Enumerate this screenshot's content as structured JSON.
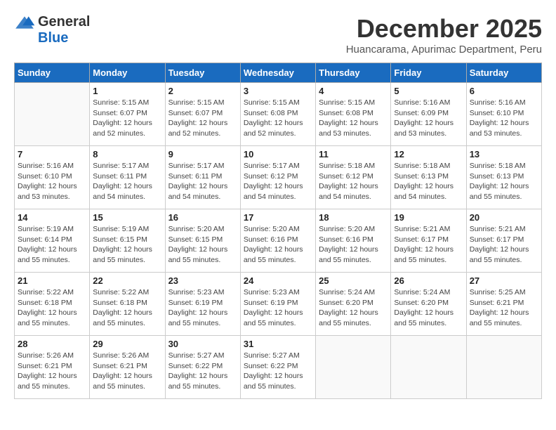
{
  "logo": {
    "general": "General",
    "blue": "Blue"
  },
  "title": {
    "month": "December 2025",
    "location": "Huancarama, Apurimac Department, Peru"
  },
  "weekdays": [
    "Sunday",
    "Monday",
    "Tuesday",
    "Wednesday",
    "Thursday",
    "Friday",
    "Saturday"
  ],
  "weeks": [
    [
      {
        "day": "",
        "sunrise": "",
        "sunset": "",
        "daylight": ""
      },
      {
        "day": "1",
        "sunrise": "Sunrise: 5:15 AM",
        "sunset": "Sunset: 6:07 PM",
        "daylight": "Daylight: 12 hours and 52 minutes."
      },
      {
        "day": "2",
        "sunrise": "Sunrise: 5:15 AM",
        "sunset": "Sunset: 6:07 PM",
        "daylight": "Daylight: 12 hours and 52 minutes."
      },
      {
        "day": "3",
        "sunrise": "Sunrise: 5:15 AM",
        "sunset": "Sunset: 6:08 PM",
        "daylight": "Daylight: 12 hours and 52 minutes."
      },
      {
        "day": "4",
        "sunrise": "Sunrise: 5:15 AM",
        "sunset": "Sunset: 6:08 PM",
        "daylight": "Daylight: 12 hours and 53 minutes."
      },
      {
        "day": "5",
        "sunrise": "Sunrise: 5:16 AM",
        "sunset": "Sunset: 6:09 PM",
        "daylight": "Daylight: 12 hours and 53 minutes."
      },
      {
        "day": "6",
        "sunrise": "Sunrise: 5:16 AM",
        "sunset": "Sunset: 6:10 PM",
        "daylight": "Daylight: 12 hours and 53 minutes."
      }
    ],
    [
      {
        "day": "7",
        "sunrise": "Sunrise: 5:16 AM",
        "sunset": "Sunset: 6:10 PM",
        "daylight": "Daylight: 12 hours and 53 minutes."
      },
      {
        "day": "8",
        "sunrise": "Sunrise: 5:17 AM",
        "sunset": "Sunset: 6:11 PM",
        "daylight": "Daylight: 12 hours and 54 minutes."
      },
      {
        "day": "9",
        "sunrise": "Sunrise: 5:17 AM",
        "sunset": "Sunset: 6:11 PM",
        "daylight": "Daylight: 12 hours and 54 minutes."
      },
      {
        "day": "10",
        "sunrise": "Sunrise: 5:17 AM",
        "sunset": "Sunset: 6:12 PM",
        "daylight": "Daylight: 12 hours and 54 minutes."
      },
      {
        "day": "11",
        "sunrise": "Sunrise: 5:18 AM",
        "sunset": "Sunset: 6:12 PM",
        "daylight": "Daylight: 12 hours and 54 minutes."
      },
      {
        "day": "12",
        "sunrise": "Sunrise: 5:18 AM",
        "sunset": "Sunset: 6:13 PM",
        "daylight": "Daylight: 12 hours and 54 minutes."
      },
      {
        "day": "13",
        "sunrise": "Sunrise: 5:18 AM",
        "sunset": "Sunset: 6:13 PM",
        "daylight": "Daylight: 12 hours and 55 minutes."
      }
    ],
    [
      {
        "day": "14",
        "sunrise": "Sunrise: 5:19 AM",
        "sunset": "Sunset: 6:14 PM",
        "daylight": "Daylight: 12 hours and 55 minutes."
      },
      {
        "day": "15",
        "sunrise": "Sunrise: 5:19 AM",
        "sunset": "Sunset: 6:15 PM",
        "daylight": "Daylight: 12 hours and 55 minutes."
      },
      {
        "day": "16",
        "sunrise": "Sunrise: 5:20 AM",
        "sunset": "Sunset: 6:15 PM",
        "daylight": "Daylight: 12 hours and 55 minutes."
      },
      {
        "day": "17",
        "sunrise": "Sunrise: 5:20 AM",
        "sunset": "Sunset: 6:16 PM",
        "daylight": "Daylight: 12 hours and 55 minutes."
      },
      {
        "day": "18",
        "sunrise": "Sunrise: 5:20 AM",
        "sunset": "Sunset: 6:16 PM",
        "daylight": "Daylight: 12 hours and 55 minutes."
      },
      {
        "day": "19",
        "sunrise": "Sunrise: 5:21 AM",
        "sunset": "Sunset: 6:17 PM",
        "daylight": "Daylight: 12 hours and 55 minutes."
      },
      {
        "day": "20",
        "sunrise": "Sunrise: 5:21 AM",
        "sunset": "Sunset: 6:17 PM",
        "daylight": "Daylight: 12 hours and 55 minutes."
      }
    ],
    [
      {
        "day": "21",
        "sunrise": "Sunrise: 5:22 AM",
        "sunset": "Sunset: 6:18 PM",
        "daylight": "Daylight: 12 hours and 55 minutes."
      },
      {
        "day": "22",
        "sunrise": "Sunrise: 5:22 AM",
        "sunset": "Sunset: 6:18 PM",
        "daylight": "Daylight: 12 hours and 55 minutes."
      },
      {
        "day": "23",
        "sunrise": "Sunrise: 5:23 AM",
        "sunset": "Sunset: 6:19 PM",
        "daylight": "Daylight: 12 hours and 55 minutes."
      },
      {
        "day": "24",
        "sunrise": "Sunrise: 5:23 AM",
        "sunset": "Sunset: 6:19 PM",
        "daylight": "Daylight: 12 hours and 55 minutes."
      },
      {
        "day": "25",
        "sunrise": "Sunrise: 5:24 AM",
        "sunset": "Sunset: 6:20 PM",
        "daylight": "Daylight: 12 hours and 55 minutes."
      },
      {
        "day": "26",
        "sunrise": "Sunrise: 5:24 AM",
        "sunset": "Sunset: 6:20 PM",
        "daylight": "Daylight: 12 hours and 55 minutes."
      },
      {
        "day": "27",
        "sunrise": "Sunrise: 5:25 AM",
        "sunset": "Sunset: 6:21 PM",
        "daylight": "Daylight: 12 hours and 55 minutes."
      }
    ],
    [
      {
        "day": "28",
        "sunrise": "Sunrise: 5:26 AM",
        "sunset": "Sunset: 6:21 PM",
        "daylight": "Daylight: 12 hours and 55 minutes."
      },
      {
        "day": "29",
        "sunrise": "Sunrise: 5:26 AM",
        "sunset": "Sunset: 6:21 PM",
        "daylight": "Daylight: 12 hours and 55 minutes."
      },
      {
        "day": "30",
        "sunrise": "Sunrise: 5:27 AM",
        "sunset": "Sunset: 6:22 PM",
        "daylight": "Daylight: 12 hours and 55 minutes."
      },
      {
        "day": "31",
        "sunrise": "Sunrise: 5:27 AM",
        "sunset": "Sunset: 6:22 PM",
        "daylight": "Daylight: 12 hours and 55 minutes."
      },
      {
        "day": "",
        "sunrise": "",
        "sunset": "",
        "daylight": ""
      },
      {
        "day": "",
        "sunrise": "",
        "sunset": "",
        "daylight": ""
      },
      {
        "day": "",
        "sunrise": "",
        "sunset": "",
        "daylight": ""
      }
    ]
  ]
}
